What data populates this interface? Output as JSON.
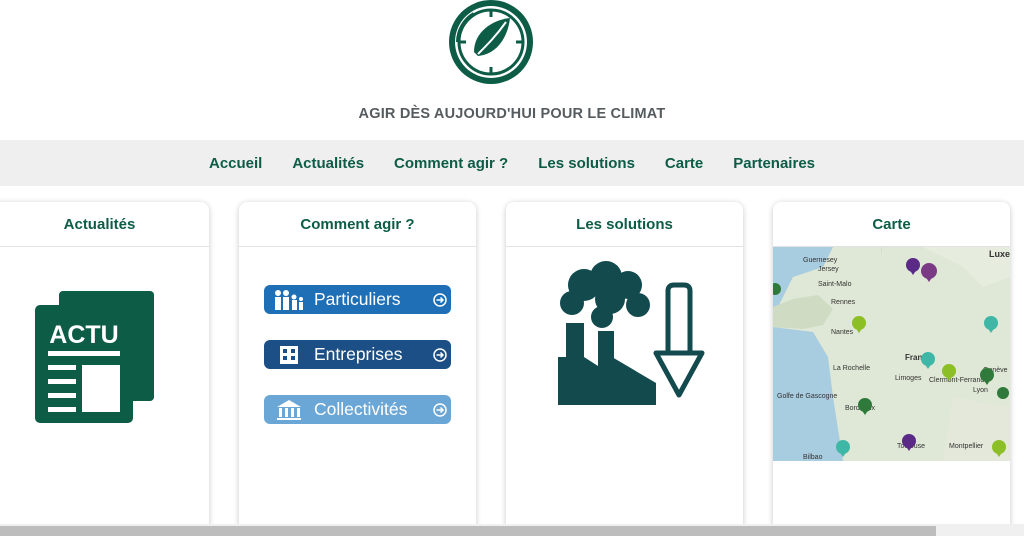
{
  "header": {
    "tagline": "AGIR DÈS AUJOURD'HUI POUR LE CLIMAT",
    "logo_icon": "clock-leaf-icon"
  },
  "nav": {
    "items": [
      "Accueil",
      "Actualités",
      "Comment agir ?",
      "Les solutions",
      "Carte",
      "Partenaires"
    ]
  },
  "cards": {
    "actualites": {
      "title": "Actualités",
      "icon_text": "ACTU",
      "icon": "newspaper-icon"
    },
    "comment_agir": {
      "title": "Comment agir ?",
      "buttons": [
        "Particuliers",
        "Entreprises",
        "Collectivités"
      ]
    },
    "solutions": {
      "title": "Les solutions",
      "icon": "factory-decrease-icon"
    },
    "carte": {
      "title": "Carte",
      "labels": {
        "guernsey": "Guernesey",
        "jersey": "Jersey",
        "saint_malo": "Saint-Malo",
        "rennes": "Rennes",
        "nantes": "Nantes",
        "la_rochelle": "La Rochelle",
        "limoges": "Limoges",
        "clermont": "Clermont-Ferrand",
        "france": "France",
        "golfe": "Golfe de Gascogne",
        "bordeaux": "Bordeaux",
        "toulouse": "Toulouse",
        "montpellier": "Montpellier",
        "bilbao": "Bilbao",
        "luxe": "Luxe",
        "geneve": "Genève",
        "lyon": "Lyon"
      }
    }
  },
  "colors": {
    "brand_green": "#0d5c46",
    "dark_teal": "#124a4e"
  }
}
